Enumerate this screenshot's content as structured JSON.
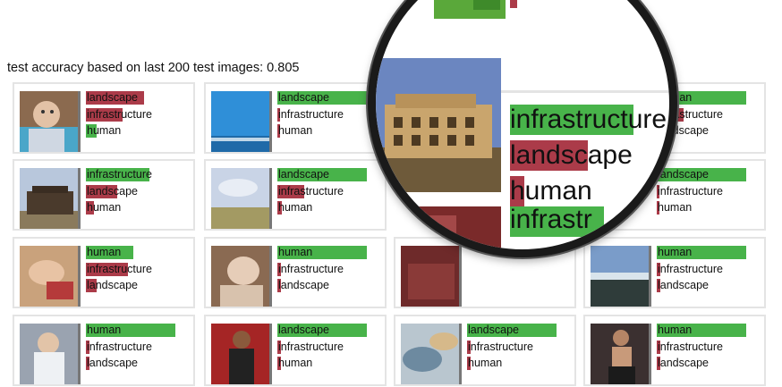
{
  "header": {
    "accuracy_text": "test accuracy based on last 200 test images: 0.805"
  },
  "colors": {
    "correct": "#48b34a",
    "wrong": "#ab3b49",
    "card_border": "#e4e4e4"
  },
  "cards": [
    {
      "labels": [
        {
          "text": "landscape",
          "score": 0.55,
          "correct": false
        },
        {
          "text": "infrastructure",
          "score": 0.35,
          "correct": false
        },
        {
          "text": "human",
          "score": 0.1,
          "correct": true
        }
      ]
    },
    {
      "labels": [
        {
          "text": "landscape",
          "score": 0.85,
          "correct": true
        },
        {
          "text": "infrastructure",
          "score": 0.02,
          "correct": false
        },
        {
          "text": "human",
          "score": 0.02,
          "correct": false
        }
      ]
    },
    {
      "labels": [
        {
          "text": "infrastructure",
          "score": 0.6,
          "correct": true
        },
        {
          "text": "landscape",
          "score": 0.3,
          "correct": false
        },
        {
          "text": "human",
          "score": 0.08,
          "correct": false
        }
      ]
    },
    {
      "labels": [
        {
          "text": "landscape",
          "score": 0.85,
          "correct": true
        },
        {
          "text": "infrastructure",
          "score": 0.25,
          "correct": false
        },
        {
          "text": "human",
          "score": 0.04,
          "correct": false
        }
      ]
    },
    {
      "labels": [
        {
          "text": "human",
          "score": 0.45,
          "correct": true
        },
        {
          "text": "infrastructure",
          "score": 0.4,
          "correct": false
        },
        {
          "text": "landscape",
          "score": 0.1,
          "correct": false
        }
      ]
    },
    {
      "labels": [
        {
          "text": "human",
          "score": 0.85,
          "correct": true
        },
        {
          "text": "infrastructure",
          "score": 0.03,
          "correct": false
        },
        {
          "text": "landscape",
          "score": 0.03,
          "correct": false
        }
      ]
    },
    {
      "labels": [
        {
          "text": "human",
          "score": 0.75,
          "correct": true
        },
        {
          "text": "infrastructure",
          "score": 0.15,
          "correct": false
        },
        {
          "text": "landscape",
          "score": 0.06,
          "correct": false
        }
      ]
    },
    {
      "labels": [
        {
          "text": "human",
          "score": 0.85,
          "correct": true
        },
        {
          "text": "infrastructure",
          "score": 0.25,
          "correct": false
        },
        {
          "text": "landscape",
          "score": 0.06,
          "correct": false
        }
      ]
    },
    {
      "labels": [
        {
          "text": "landscape",
          "score": 0.85,
          "correct": true
        },
        {
          "text": "infrastructure",
          "score": 0.02,
          "correct": false
        },
        {
          "text": "human",
          "score": 0.02,
          "correct": false
        }
      ]
    },
    {
      "labels": [
        {
          "text": "human",
          "score": 0.85,
          "correct": true
        },
        {
          "text": "infrastructure",
          "score": 0.03,
          "correct": false
        },
        {
          "text": "landscape",
          "score": 0.03,
          "correct": false
        }
      ]
    },
    {
      "labels": [
        {
          "text": "human",
          "score": 0.85,
          "correct": true
        },
        {
          "text": "infrastructure",
          "score": 0.03,
          "correct": false
        },
        {
          "text": "landscape",
          "score": 0.03,
          "correct": false
        }
      ]
    },
    {
      "labels": [
        {
          "text": "landscape",
          "score": 0.85,
          "correct": true
        },
        {
          "text": "infrastructure",
          "score": 0.03,
          "correct": false
        },
        {
          "text": "human",
          "score": 0.03,
          "correct": false
        }
      ]
    },
    {
      "labels": [
        {
          "text": "landscape",
          "score": 0.85,
          "correct": true
        },
        {
          "text": "infrastructure",
          "score": 0.03,
          "correct": false
        },
        {
          "text": "human",
          "score": 0.03,
          "correct": false
        }
      ]
    },
    {
      "labels": [
        {
          "text": "human",
          "score": 0.85,
          "correct": true
        },
        {
          "text": "infrastructure",
          "score": 0.03,
          "correct": false
        },
        {
          "text": "landscape",
          "score": 0.03,
          "correct": false
        }
      ]
    }
  ],
  "magnifier": {
    "top_label": "human",
    "labels": [
      {
        "text": "infrastructure",
        "score": 0.6,
        "correct": true
      },
      {
        "text": "landscape",
        "score": 0.38,
        "correct": false
      },
      {
        "text": "human",
        "score": 0.07,
        "correct": false
      }
    ],
    "bottom_label": "infrastr"
  }
}
